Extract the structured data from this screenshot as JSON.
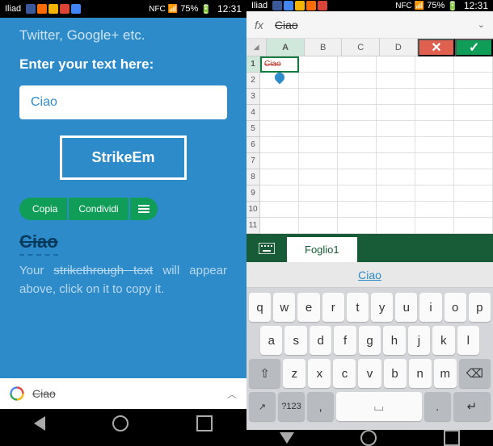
{
  "status": {
    "carrier_left": "Iliad",
    "carrier_right": "Iliad",
    "battery": "75%",
    "time": "12:31",
    "nfc": "NFC"
  },
  "webapp": {
    "subtitle": "Twitter, Google+ etc.",
    "prompt": "Enter your text here:",
    "input_value": "Ciao",
    "button": "StrikeEm",
    "copy": "Copia",
    "share": "Condividi",
    "result": "Ciao",
    "desc_a": "Your ",
    "desc_b": "strikethrough text",
    "desc_c": " will appear above, click on it to copy it.",
    "address": "Ciao"
  },
  "excel": {
    "fx": "fx",
    "formula": "Ciao",
    "cols": [
      "A",
      "B",
      "C",
      "D"
    ],
    "rows": [
      "1",
      "2",
      "3",
      "4",
      "5",
      "6",
      "7",
      "8",
      "9",
      "10",
      "11"
    ],
    "cell_a1": "Ciao",
    "sheet": "Foglio1"
  },
  "keyboard": {
    "suggestion": "Ciao",
    "row1": [
      "q",
      "w",
      "e",
      "r",
      "t",
      "y",
      "u",
      "i",
      "o",
      "p"
    ],
    "row2": [
      "a",
      "s",
      "d",
      "f",
      "g",
      "h",
      "j",
      "k",
      "l"
    ],
    "row3": [
      "z",
      "x",
      "c",
      "v",
      "b",
      "n",
      "m"
    ],
    "shift": "⇧",
    "backspace": "⌫",
    "numeric": "?123",
    "enter": "↵"
  }
}
